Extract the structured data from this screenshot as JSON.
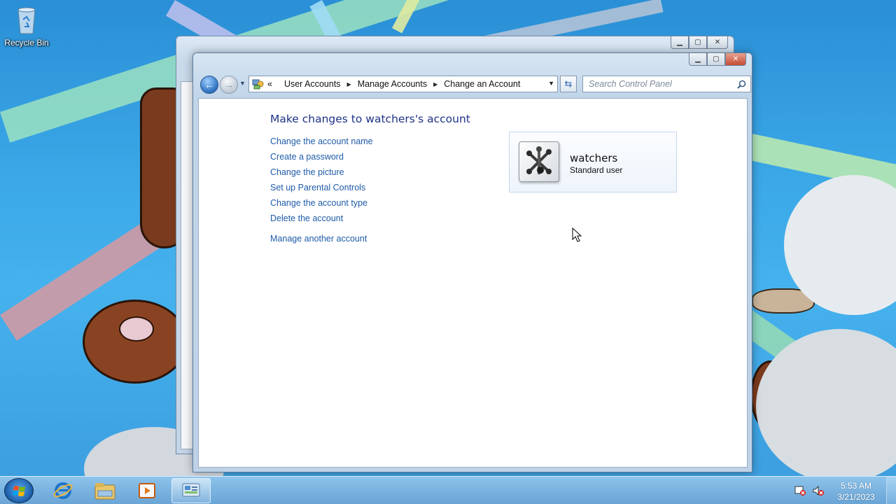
{
  "desktop": {
    "icons": [
      {
        "label": "Recycle Bin"
      }
    ]
  },
  "window": {
    "breadcrumb": {
      "overflow_glyph": "«",
      "items": [
        "User Accounts",
        "Manage Accounts",
        "Change an Account"
      ]
    },
    "search": {
      "placeholder": "Search Control Panel"
    },
    "page": {
      "heading": "Make changes to watchers's account",
      "tasks": [
        "Change the account name",
        "Create a password",
        "Change the picture",
        "Set up Parental Controls",
        "Change the account type",
        "Delete the account"
      ],
      "other_task": "Manage another account"
    },
    "account": {
      "name": "watchers",
      "type": "Standard user"
    }
  },
  "taskbar": {
    "pinned": [
      "internet-explorer-icon",
      "windows-explorer-icon",
      "media-player-icon",
      "control-panel-icon"
    ],
    "clock": {
      "time": "5:53 AM",
      "date": "3/21/2023"
    }
  },
  "colors": {
    "link": "#1e5ba8",
    "heading": "#1e3287",
    "desktop_sky": "#3aa6e6",
    "taskbar": "#7ab3e0"
  }
}
